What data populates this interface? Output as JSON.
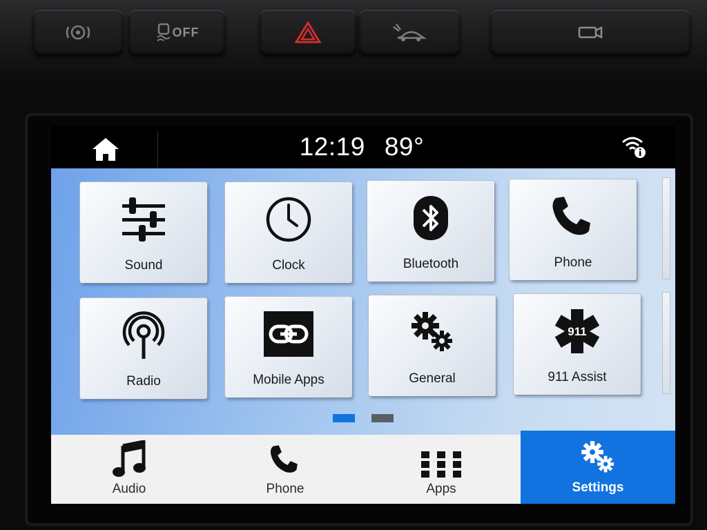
{
  "hardware": {
    "buttons": [
      {
        "id": "traction-control",
        "icon": "traction-control-icon"
      },
      {
        "id": "traction-off",
        "icon": "traction-off-icon",
        "label": "OFF"
      },
      {
        "id": "hazard",
        "icon": "hazard-warning-icon"
      },
      {
        "id": "parking-assist",
        "icon": "parking-assist-icon"
      },
      {
        "id": "camera",
        "icon": "camera-icon"
      }
    ]
  },
  "status_bar": {
    "time": "12:19",
    "temperature": "89°",
    "home_icon": "home-icon",
    "wifi_icon": "wifi-info-icon"
  },
  "tiles": [
    {
      "label": "Sound",
      "icon": "sliders-icon"
    },
    {
      "label": "Clock",
      "icon": "clock-icon"
    },
    {
      "label": "Bluetooth",
      "icon": "bluetooth-icon"
    },
    {
      "label": "Phone",
      "icon": "phone-icon"
    },
    {
      "label": "Radio",
      "icon": "radio-antenna-icon"
    },
    {
      "label": "Mobile Apps",
      "icon": "link-icon"
    },
    {
      "label": "General",
      "icon": "gears-icon"
    },
    {
      "label": "911 Assist",
      "icon": "star-of-life-icon",
      "badge": "911"
    }
  ],
  "pager": {
    "pages": 2,
    "active": 1
  },
  "bottom_nav": [
    {
      "label": "Audio",
      "icon": "music-note-icon",
      "active": false
    },
    {
      "label": "Phone",
      "icon": "phone-icon",
      "active": false
    },
    {
      "label": "Apps",
      "icon": "grid-icon",
      "active": false
    },
    {
      "label": "Settings",
      "icon": "gears-icon",
      "active": true
    }
  ],
  "colors": {
    "accent": "#1173e0",
    "pager_active": "#1173e0",
    "pager_inactive": "#5a5f66",
    "hazard": "#d42c2c"
  }
}
